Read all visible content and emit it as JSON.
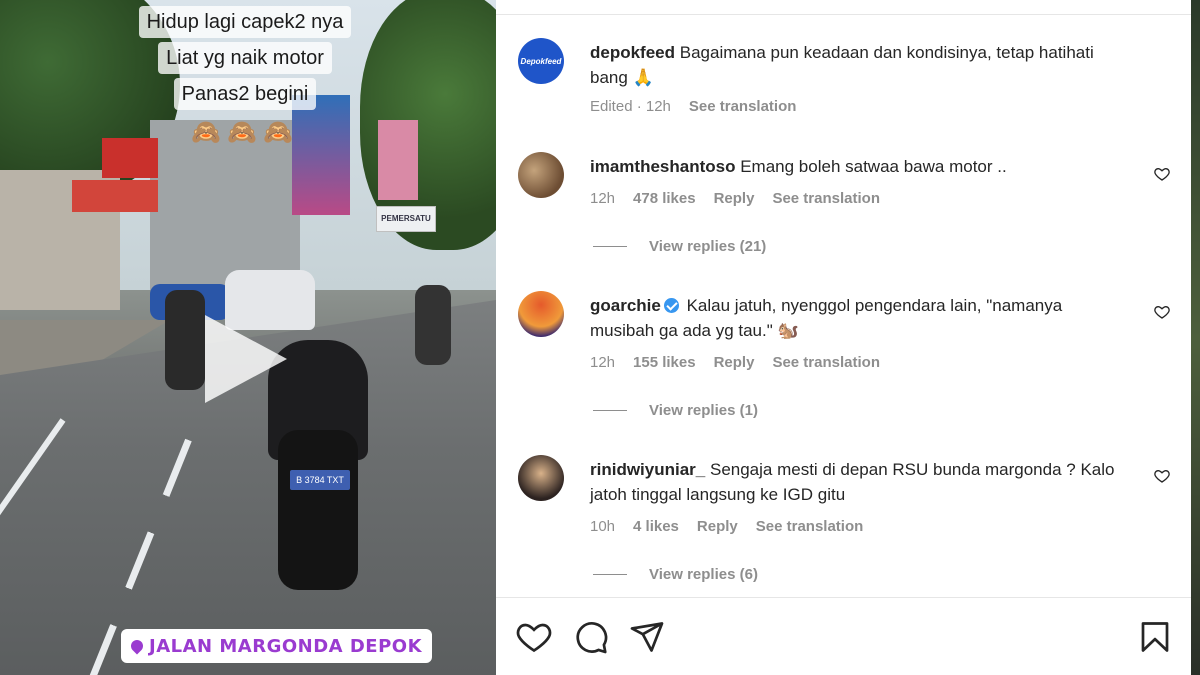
{
  "video": {
    "caption_lines": [
      "Hidup lagi capek2 nya",
      "Liat yg naik motor",
      "Panas2 begini"
    ],
    "caption_emoji": "🙈🙈🙈",
    "location_label": "JALAN MARGONDA DEPOK",
    "sign_text": "PEMERSATU",
    "plate_text": "B 3784 TXT"
  },
  "post": {
    "author_avatar_text": "Depokfeed",
    "author": "depokfeed",
    "text": "Bagaimana pun keadaan dan kondisinya, tetap hatihati bang 🙏",
    "meta_time": "Edited · 12h",
    "meta_translate": "See translation"
  },
  "comments": [
    {
      "user": "imamtheshantoso",
      "text": "Emang boleh satwaa bawa motor ..",
      "time": "12h",
      "likes": "478 likes",
      "reply": "Reply",
      "translate": "See translation",
      "view_replies": "View replies (21)"
    },
    {
      "user": "goarchie",
      "verified": true,
      "text": "Kalau jatuh, nyenggol pengendara lain, \"namanya musibah ga ada yg tau.\" 🐿️",
      "time": "12h",
      "likes": "155 likes",
      "reply": "Reply",
      "translate": "See translation",
      "view_replies": "View replies (1)"
    },
    {
      "user": "rinidwiyuniar_",
      "text": "Sengaja mesti di depan RSU bunda margonda ? Kalo jatoh tinggal langsung ke IGD gitu",
      "time": "10h",
      "likes": "4 likes",
      "reply": "Reply",
      "translate": "See translation",
      "view_replies": "View replies (6)"
    }
  ],
  "actions": [
    "heart-icon",
    "comment-icon",
    "share-icon",
    "bookmark-icon"
  ],
  "colors": {
    "location_purple": "#9a3bd0",
    "verified_blue": "#3897f0",
    "muted_gray": "#8e8e8e"
  }
}
